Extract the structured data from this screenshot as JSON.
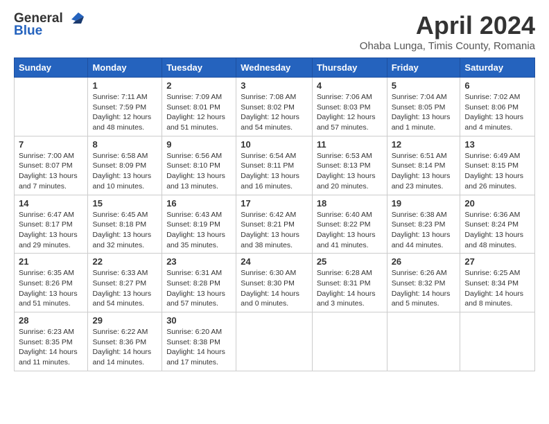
{
  "header": {
    "logo_general": "General",
    "logo_blue": "Blue",
    "month_title": "April 2024",
    "location": "Ohaba Lunga, Timis County, Romania"
  },
  "weekdays": [
    "Sunday",
    "Monday",
    "Tuesday",
    "Wednesday",
    "Thursday",
    "Friday",
    "Saturday"
  ],
  "weeks": [
    [
      {
        "day": "",
        "info": ""
      },
      {
        "day": "1",
        "info": "Sunrise: 7:11 AM\nSunset: 7:59 PM\nDaylight: 12 hours\nand 48 minutes."
      },
      {
        "day": "2",
        "info": "Sunrise: 7:09 AM\nSunset: 8:01 PM\nDaylight: 12 hours\nand 51 minutes."
      },
      {
        "day": "3",
        "info": "Sunrise: 7:08 AM\nSunset: 8:02 PM\nDaylight: 12 hours\nand 54 minutes."
      },
      {
        "day": "4",
        "info": "Sunrise: 7:06 AM\nSunset: 8:03 PM\nDaylight: 12 hours\nand 57 minutes."
      },
      {
        "day": "5",
        "info": "Sunrise: 7:04 AM\nSunset: 8:05 PM\nDaylight: 13 hours\nand 1 minute."
      },
      {
        "day": "6",
        "info": "Sunrise: 7:02 AM\nSunset: 8:06 PM\nDaylight: 13 hours\nand 4 minutes."
      }
    ],
    [
      {
        "day": "7",
        "info": "Sunrise: 7:00 AM\nSunset: 8:07 PM\nDaylight: 13 hours\nand 7 minutes."
      },
      {
        "day": "8",
        "info": "Sunrise: 6:58 AM\nSunset: 8:09 PM\nDaylight: 13 hours\nand 10 minutes."
      },
      {
        "day": "9",
        "info": "Sunrise: 6:56 AM\nSunset: 8:10 PM\nDaylight: 13 hours\nand 13 minutes."
      },
      {
        "day": "10",
        "info": "Sunrise: 6:54 AM\nSunset: 8:11 PM\nDaylight: 13 hours\nand 16 minutes."
      },
      {
        "day": "11",
        "info": "Sunrise: 6:53 AM\nSunset: 8:13 PM\nDaylight: 13 hours\nand 20 minutes."
      },
      {
        "day": "12",
        "info": "Sunrise: 6:51 AM\nSunset: 8:14 PM\nDaylight: 13 hours\nand 23 minutes."
      },
      {
        "day": "13",
        "info": "Sunrise: 6:49 AM\nSunset: 8:15 PM\nDaylight: 13 hours\nand 26 minutes."
      }
    ],
    [
      {
        "day": "14",
        "info": "Sunrise: 6:47 AM\nSunset: 8:17 PM\nDaylight: 13 hours\nand 29 minutes."
      },
      {
        "day": "15",
        "info": "Sunrise: 6:45 AM\nSunset: 8:18 PM\nDaylight: 13 hours\nand 32 minutes."
      },
      {
        "day": "16",
        "info": "Sunrise: 6:43 AM\nSunset: 8:19 PM\nDaylight: 13 hours\nand 35 minutes."
      },
      {
        "day": "17",
        "info": "Sunrise: 6:42 AM\nSunset: 8:21 PM\nDaylight: 13 hours\nand 38 minutes."
      },
      {
        "day": "18",
        "info": "Sunrise: 6:40 AM\nSunset: 8:22 PM\nDaylight: 13 hours\nand 41 minutes."
      },
      {
        "day": "19",
        "info": "Sunrise: 6:38 AM\nSunset: 8:23 PM\nDaylight: 13 hours\nand 44 minutes."
      },
      {
        "day": "20",
        "info": "Sunrise: 6:36 AM\nSunset: 8:24 PM\nDaylight: 13 hours\nand 48 minutes."
      }
    ],
    [
      {
        "day": "21",
        "info": "Sunrise: 6:35 AM\nSunset: 8:26 PM\nDaylight: 13 hours\nand 51 minutes."
      },
      {
        "day": "22",
        "info": "Sunrise: 6:33 AM\nSunset: 8:27 PM\nDaylight: 13 hours\nand 54 minutes."
      },
      {
        "day": "23",
        "info": "Sunrise: 6:31 AM\nSunset: 8:28 PM\nDaylight: 13 hours\nand 57 minutes."
      },
      {
        "day": "24",
        "info": "Sunrise: 6:30 AM\nSunset: 8:30 PM\nDaylight: 14 hours\nand 0 minutes."
      },
      {
        "day": "25",
        "info": "Sunrise: 6:28 AM\nSunset: 8:31 PM\nDaylight: 14 hours\nand 3 minutes."
      },
      {
        "day": "26",
        "info": "Sunrise: 6:26 AM\nSunset: 8:32 PM\nDaylight: 14 hours\nand 5 minutes."
      },
      {
        "day": "27",
        "info": "Sunrise: 6:25 AM\nSunset: 8:34 PM\nDaylight: 14 hours\nand 8 minutes."
      }
    ],
    [
      {
        "day": "28",
        "info": "Sunrise: 6:23 AM\nSunset: 8:35 PM\nDaylight: 14 hours\nand 11 minutes."
      },
      {
        "day": "29",
        "info": "Sunrise: 6:22 AM\nSunset: 8:36 PM\nDaylight: 14 hours\nand 14 minutes."
      },
      {
        "day": "30",
        "info": "Sunrise: 6:20 AM\nSunset: 8:38 PM\nDaylight: 14 hours\nand 17 minutes."
      },
      {
        "day": "",
        "info": ""
      },
      {
        "day": "",
        "info": ""
      },
      {
        "day": "",
        "info": ""
      },
      {
        "day": "",
        "info": ""
      }
    ]
  ]
}
